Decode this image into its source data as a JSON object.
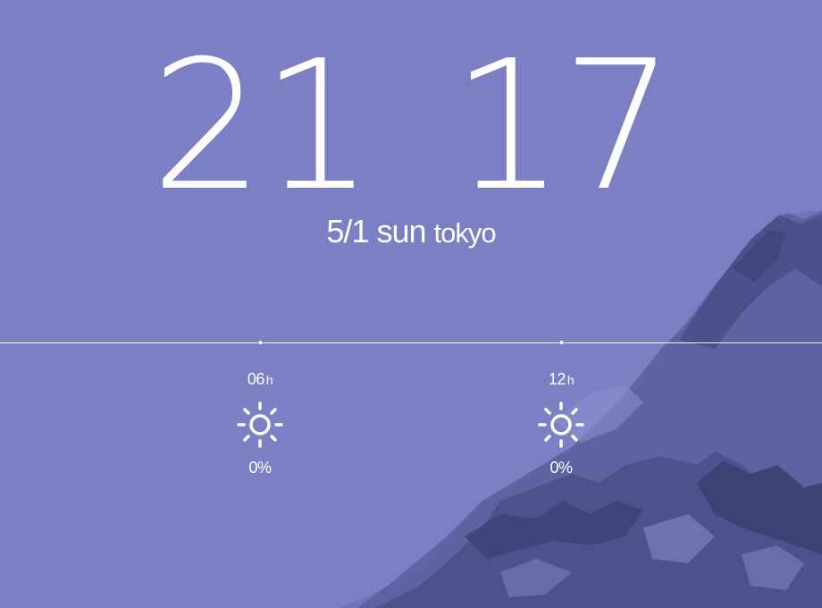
{
  "clock": {
    "hour": "21",
    "minute": "17"
  },
  "date": {
    "day": "5/1",
    "weekday": "sun",
    "city": "tokyo"
  },
  "forecast": [
    {
      "hour": "06",
      "unit": "h",
      "icon": "sun-icon",
      "precip": "0%"
    },
    {
      "hour": "12",
      "unit": "h",
      "icon": "sun-icon",
      "precip": "0%"
    }
  ],
  "colors": {
    "background": "#7b80c5",
    "mountain_dark": "#4e5389",
    "mountain_light": "#9aa0d8",
    "text": "#ffffff"
  }
}
